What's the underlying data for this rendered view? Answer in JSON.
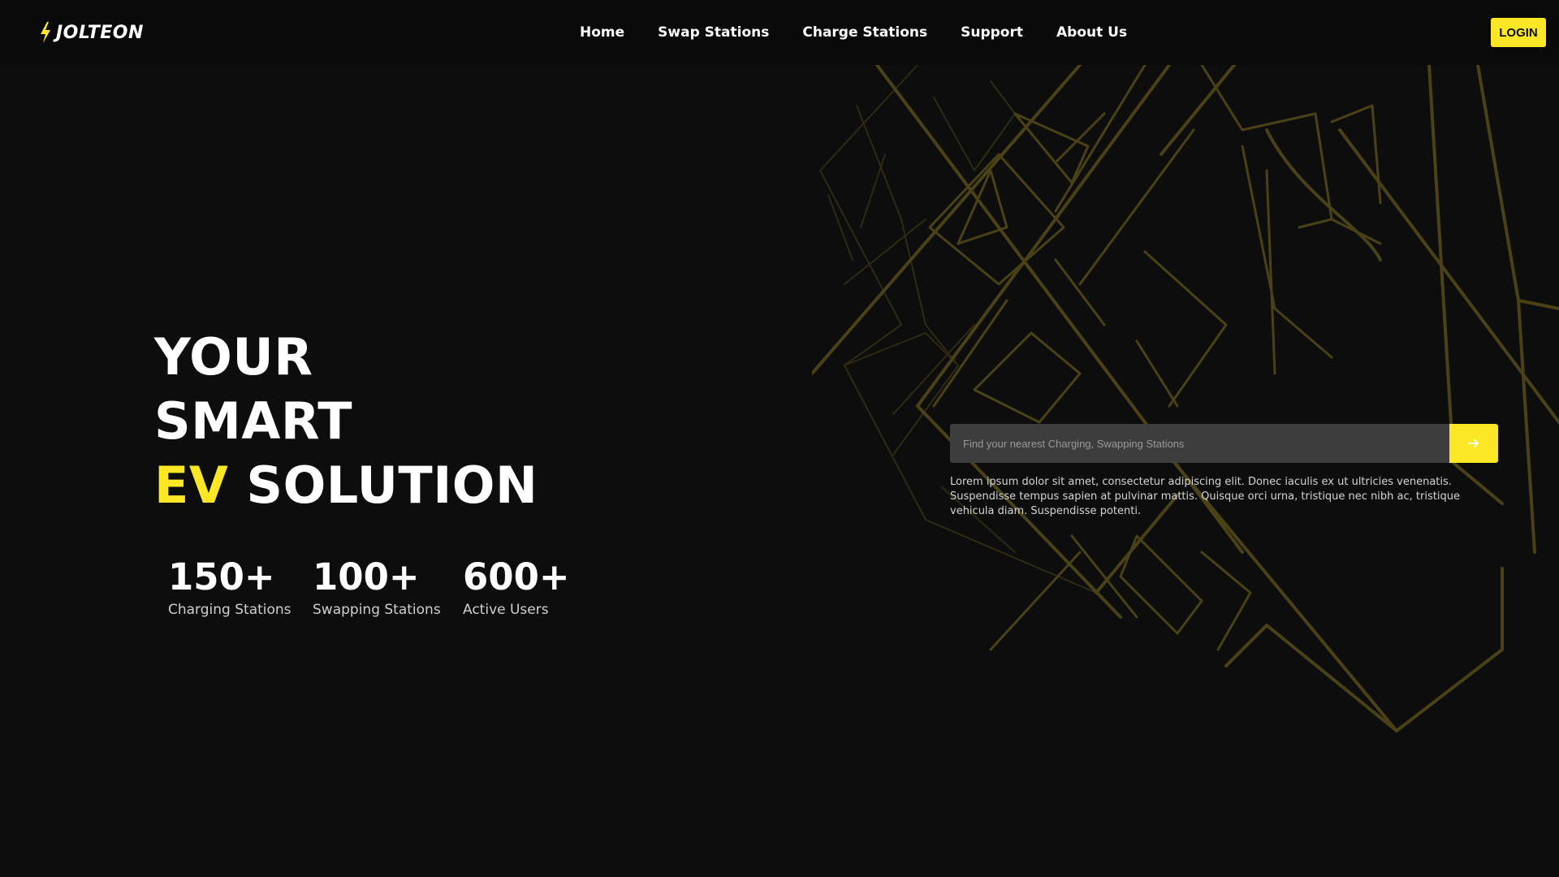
{
  "header": {
    "logo_text": "JOLTEON",
    "nav": [
      {
        "label": "Home"
      },
      {
        "label": "Swap Stations"
      },
      {
        "label": "Charge Stations"
      },
      {
        "label": "Support"
      },
      {
        "label": "About Us"
      }
    ],
    "login_label": "LOGIN"
  },
  "hero": {
    "line1": "YOUR",
    "line2": "SMART",
    "line3_highlight": "EV",
    "line3_rest": " SOLUTION"
  },
  "stats": [
    {
      "value": "150+",
      "label": "Charging Stations"
    },
    {
      "value": "100+",
      "label": "Swapping Stations"
    },
    {
      "value": "600+",
      "label": "Active Users"
    }
  ],
  "search": {
    "placeholder": "Find your nearest Charging, Swapping Stations",
    "description": "Lorem ipsum dolor sit amet, consectetur adipiscing elit. Donec iaculis ex ut ultricies venenatis. Suspendisse tempus sapien at pulvinar mattis. Quisque orci urna, tristique nec nibh ac, tristique vehicula diam. Suspendisse potenti."
  },
  "colors": {
    "accent": "#fce726",
    "background": "#0d0d0d",
    "input_bg": "#3d3d3d",
    "map_lines": "#4a4216"
  },
  "icons": {
    "logo": "lightning-bolt-icon",
    "search_submit": "arrow-right-icon"
  }
}
